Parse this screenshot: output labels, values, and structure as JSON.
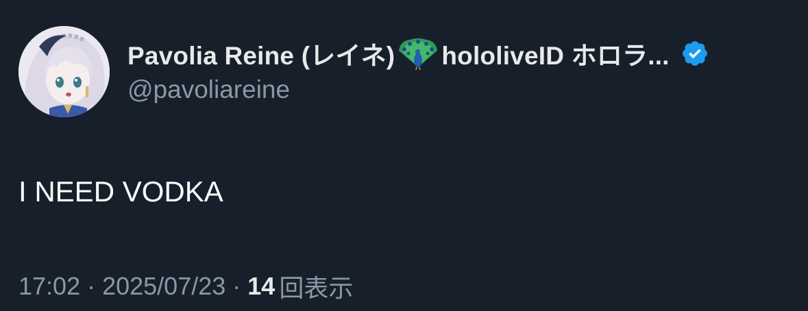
{
  "colors": {
    "background": "#17202a",
    "text_primary": "#e7e9ea",
    "text_secondary": "#8b98a5",
    "verified_blue": "#1d9bf0"
  },
  "author": {
    "avatar_icon": "avatar-anime-character",
    "name_text": "Pavolia Reine (レイネ)",
    "name_emoji_icon": "peacock-emoji",
    "name_suffix": "hololiveID ホロラ...",
    "verified_icon": "verified-badge-icon",
    "handle": "@pavoliareine"
  },
  "tweet": {
    "text": "I NEED VODKA"
  },
  "meta": {
    "time": "17:02",
    "separator": "·",
    "date": "2025/07/23",
    "views_count": "14",
    "views_label": "回表示"
  }
}
